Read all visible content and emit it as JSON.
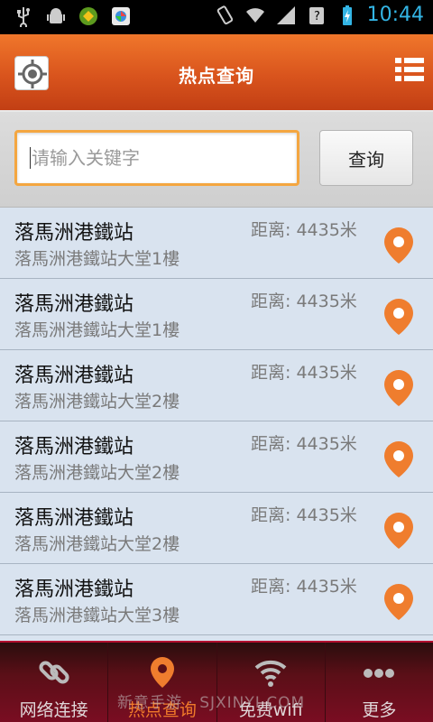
{
  "status_bar": {
    "time": "10:44"
  },
  "header": {
    "title": "热点查询"
  },
  "search": {
    "placeholder": "请输入关键字",
    "button_label": "查询"
  },
  "list": [
    {
      "name": "落馬洲港鐵站",
      "address": "落馬洲港鐵站大堂1樓",
      "distance": "距离: 4435米"
    },
    {
      "name": "落馬洲港鐵站",
      "address": "落馬洲港鐵站大堂1樓",
      "distance": "距离: 4435米"
    },
    {
      "name": "落馬洲港鐵站",
      "address": "落馬洲港鐵站大堂2樓",
      "distance": "距离: 4435米"
    },
    {
      "name": "落馬洲港鐵站",
      "address": "落馬洲港鐵站大堂2樓",
      "distance": "距离: 4435米"
    },
    {
      "name": "落馬洲港鐵站",
      "address": "落馬洲港鐵站大堂2樓",
      "distance": "距离: 4435米"
    },
    {
      "name": "落馬洲港鐵站",
      "address": "落馬洲港鐵站大堂3樓",
      "distance": "距离: 4435米"
    }
  ],
  "bottom_nav": [
    {
      "label": "网络连接",
      "icon": "link-icon"
    },
    {
      "label": "热点查询",
      "icon": "location-pin-icon",
      "active": true
    },
    {
      "label": "免费wifi",
      "icon": "wifi-icon"
    },
    {
      "label": "更多",
      "icon": "more-icon"
    }
  ],
  "watermark": "新意手游 · SJXINYI.COM",
  "colors": {
    "accent": "#e8622a",
    "nav_bg": "#5a0f17",
    "clock": "#33b5e5"
  }
}
